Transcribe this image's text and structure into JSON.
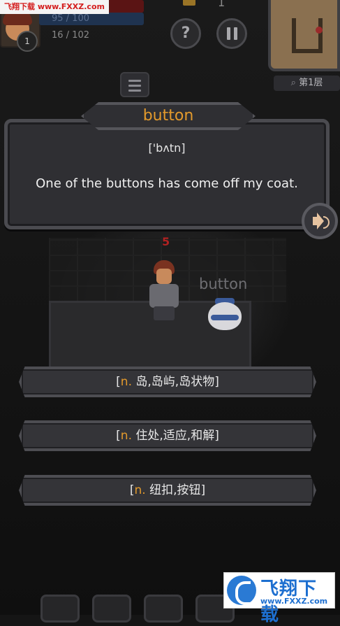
{
  "watermark": {
    "top_left": "飞翔下载 www.FXXZ.com"
  },
  "hud": {
    "hp": "95 / 100",
    "hp_partial": "100",
    "mp": "95 / 100",
    "xp": "16 / 102",
    "level": "1",
    "coins": "1",
    "help_label": "?",
    "floor": "第1层"
  },
  "dialog": {
    "word": "button",
    "phonetic": "['bʌtn]",
    "sentence": "One of the buttons has come off my coat."
  },
  "scene": {
    "damage": "5",
    "word_tag": "button"
  },
  "answers": [
    {
      "prefix": "[",
      "pos": "n.",
      "meaning": " 岛,岛屿,岛状物]"
    },
    {
      "prefix": "[",
      "pos": "n.",
      "meaning": " 住处,适应,和解]"
    },
    {
      "prefix": "[",
      "pos": "n.",
      "meaning": " 纽扣,按钮]"
    }
  ],
  "logo": {
    "title": "飞翔下载",
    "url": "www.FXXZ.com"
  },
  "colors": {
    "accent": "#e39a2c",
    "background": "#151515",
    "panel": "#2f2f33"
  },
  "icons": [
    "avatar",
    "coin-icon",
    "help-icon",
    "pause-icon",
    "search-icon",
    "menu-list-icon",
    "speaker-icon"
  ]
}
